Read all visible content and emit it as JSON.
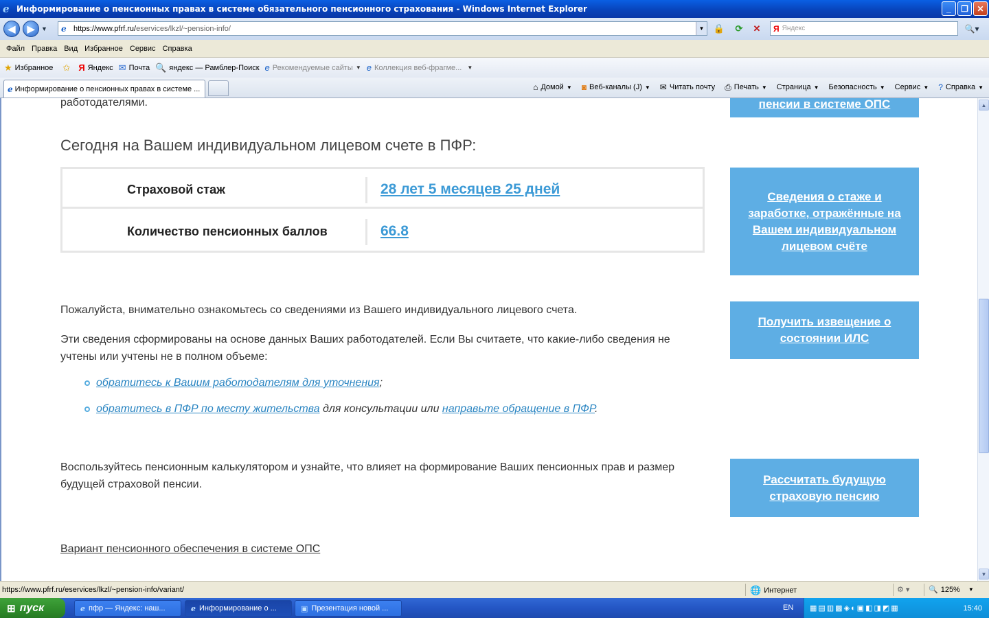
{
  "window": {
    "title": "Информирование о пенсионных правах в системе обязательного пенсионного страхования - Windows Internet Explorer",
    "min_label": "_",
    "max_label": "❐",
    "close_label": "✕"
  },
  "address": {
    "url_host": "https://www.pfrf.ru/",
    "url_rest": "eservices/lkzl/~pension-info/",
    "search_placeholder": "Яндекс"
  },
  "menu": [
    "Файл",
    "Правка",
    "Вид",
    "Избранное",
    "Сервис",
    "Справка"
  ],
  "favorites": {
    "favorites_label": "Избранное",
    "items": [
      "Яндекс",
      "Почта",
      "яндекс — Рамблер-Поиск",
      "Рекомендуемые сайты",
      "Коллекция веб-фрагме..."
    ]
  },
  "tab": {
    "label": "Информирование о пенсионных правах в системе ..."
  },
  "commands": [
    "Домой",
    "Веб-каналы (J)",
    "Читать почту",
    "Печать",
    "Страница",
    "Безопасность",
    "Сервис",
    "Справка"
  ],
  "content": {
    "prev_line": "работодателями.",
    "heading": "Сегодня на Вашем индивидуальном лицевом счете в ПФР:",
    "rows": [
      {
        "label": "Страховой стаж",
        "value": "28 лет 5 месяцев 25 дней"
      },
      {
        "label": "Количество пенсионных баллов",
        "value": "66.8"
      }
    ],
    "p1": "Пожалуйста, внимательно ознакомьтесь со сведениями из Вашего индивидуального лицевого счета.",
    "p2": "Эти сведения сформированы на основе данных Ваших работодателей. Если Вы считаете, что какие-либо сведения не учтены или учтены не в полном объеме:",
    "bullet1_link": "обратитесь к Вашим работодателям для уточнения",
    "bullet1_tail": ";",
    "bullet2_link1": "обратитесь в ПФР по месту жительства",
    "bullet2_mid": " для консультации или ",
    "bullet2_link2": "направьте обращение в ПФР",
    "bullet2_tail": ".",
    "p3": "Воспользуйтесь пенсионным калькулятором и узнайте, что влияет на формирование Ваших пенсионных прав и размер будущей страховой пенсии.",
    "p4": "Вариант пенсионного обеспечения в системе ОПС"
  },
  "sidebar": {
    "btn0": "пенсии в системе ОПС",
    "btn1": "Сведения о стаже и заработке, отражённые на Вашем индивидуальном лицевом счёте",
    "btn2": "Получить извещение о состоянии ИЛС",
    "btn3": "Рассчитать будущую страховую пенсию"
  },
  "status": {
    "url": "https://www.pfrf.ru/eservices/lkzl/~pension-info/variant/",
    "zone": "Интернет",
    "zoom": "125%"
  },
  "taskbar": {
    "start": "пуск",
    "tasks": [
      "пфр — Яндекс: наш...",
      "Информирование о ...",
      "Презентация новой ..."
    ],
    "lang": "EN",
    "clock": "15:40"
  },
  "colors": {
    "accent": "#5eaee4",
    "link": "#2a85c2",
    "value": "#3c9ad6"
  }
}
